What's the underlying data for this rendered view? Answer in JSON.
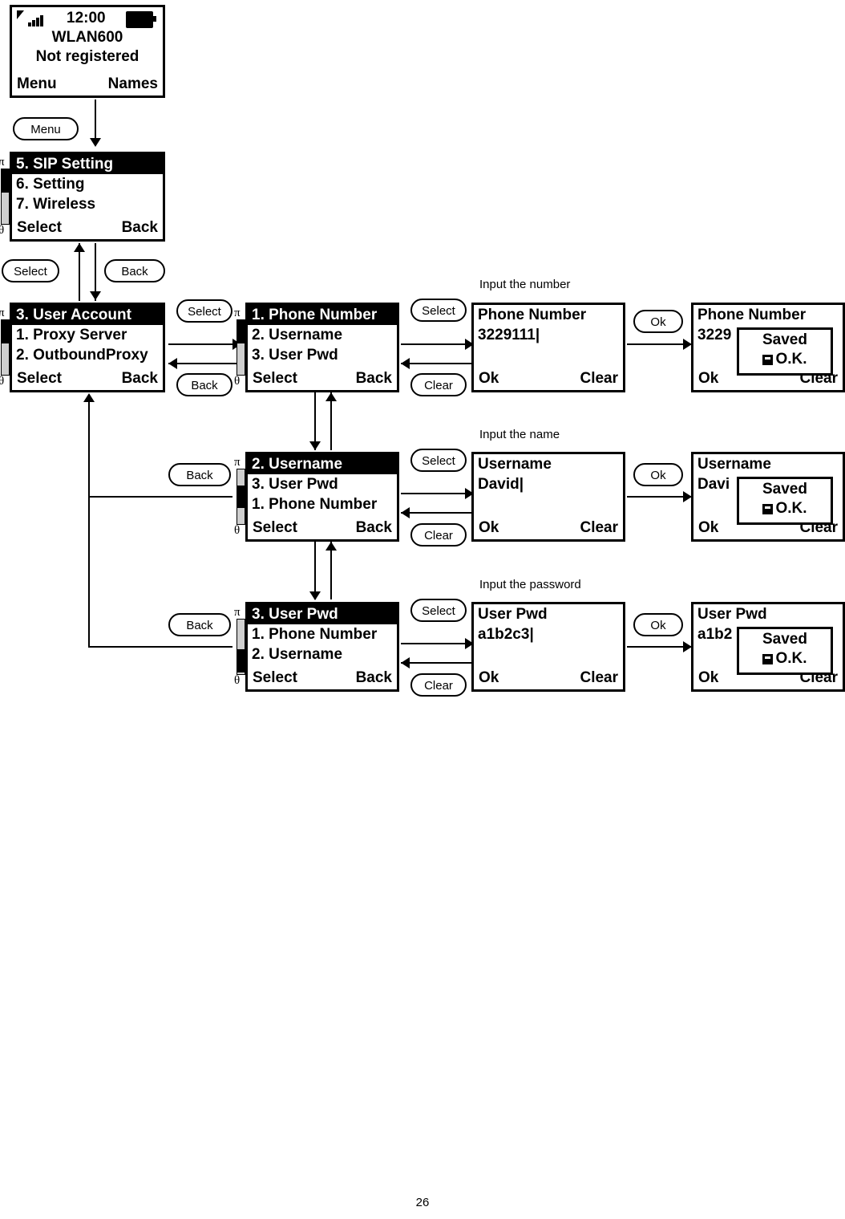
{
  "page": {
    "number": "26"
  },
  "idle_screen": {
    "time": "12:00",
    "line1": "WLAN600",
    "line2": "Not registered",
    "softkey_left": "Menu",
    "softkey_right": "Names"
  },
  "buttons": {
    "menu": "Menu",
    "select": "Select",
    "back": "Back",
    "clear": "Clear",
    "ok": "Ok"
  },
  "notes": {
    "input_number": "Input the number",
    "input_name": "Input the name",
    "input_password": "Input the password"
  },
  "screens": {
    "sip_setting": {
      "rows": [
        "5. SIP Setting",
        "6. Setting",
        "7. Wireless"
      ],
      "softkey_left": "Select",
      "softkey_right": "Back"
    },
    "user_account": {
      "rows": [
        "3. User Account",
        "1. Proxy Server",
        "2. OutboundProxy"
      ],
      "softkey_left": "Select",
      "softkey_right": "Back"
    },
    "phone_number_menu": {
      "rows": [
        "1. Phone Number",
        "2. Username",
        "3. User Pwd"
      ],
      "softkey_left": "Select",
      "softkey_right": "Back"
    },
    "username_menu": {
      "rows": [
        "2. Username",
        "3. User Pwd",
        "1. Phone Number"
      ],
      "softkey_left": "Select",
      "softkey_right": "Back"
    },
    "user_pwd_menu": {
      "rows": [
        "3. User Pwd",
        "1. Phone Number",
        "2. Username"
      ],
      "softkey_left": "Select",
      "softkey_right": "Back"
    },
    "phone_number_edit": {
      "title": "Phone Number",
      "value": "3229111|",
      "softkey_left": "Ok",
      "softkey_right": "Clear"
    },
    "phone_number_saved": {
      "title": "Phone Number",
      "value": "3229",
      "softkey_left": "Ok",
      "softkey_right": "Clear",
      "popup_line1": "Saved",
      "popup_line2": "O.K."
    },
    "username_edit": {
      "title": "Username",
      "value": "David|",
      "softkey_left": "Ok",
      "softkey_right": "Clear"
    },
    "username_saved": {
      "title": "Username",
      "value": "Davi",
      "softkey_left": "Ok",
      "softkey_right": "Clear",
      "popup_line1": "Saved",
      "popup_line2": "O.K."
    },
    "user_pwd_edit": {
      "title": "User Pwd",
      "value": "a1b2c3|",
      "softkey_left": "Ok",
      "softkey_right": "Clear"
    },
    "user_pwd_saved": {
      "title": "User Pwd",
      "value": "a1b2",
      "softkey_left": "Ok",
      "softkey_right": "Clear",
      "popup_line1": "Saved",
      "popup_line2": "O.K."
    }
  }
}
